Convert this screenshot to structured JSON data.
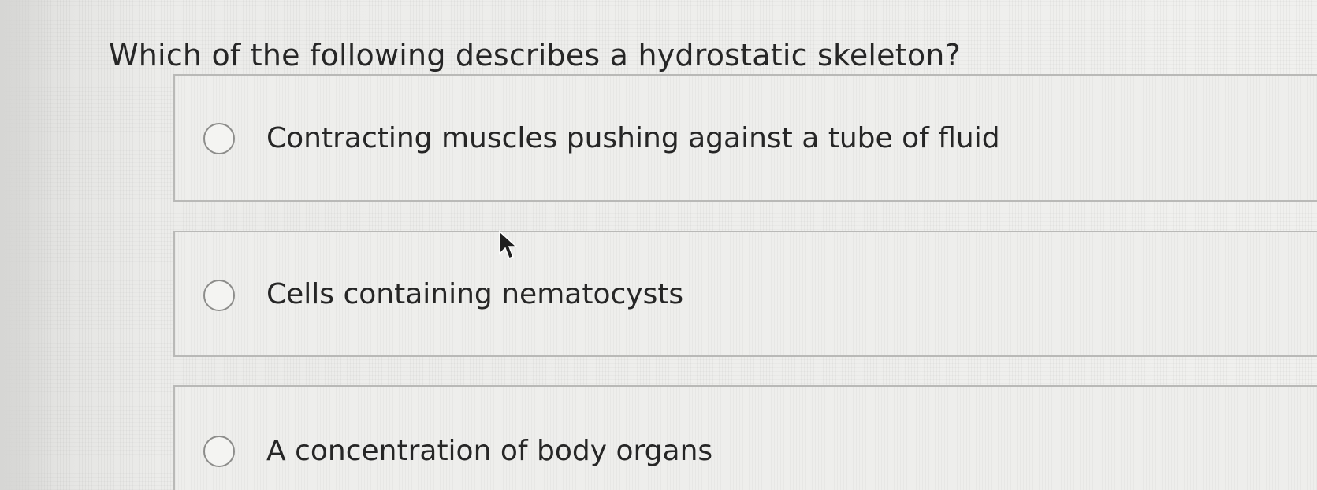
{
  "question": {
    "text": "Which of the following describes a hydrostatic skeleton?"
  },
  "choices": [
    {
      "label": "Contracting muscles pushing against a tube of fluid",
      "selected": false
    },
    {
      "label": "Cells containing nematocysts",
      "selected": false
    },
    {
      "label": "A concentration of body organs",
      "selected": false
    }
  ],
  "icons": {
    "radio": "radio-unselected-icon",
    "cursor": "mouse-pointer-icon"
  }
}
